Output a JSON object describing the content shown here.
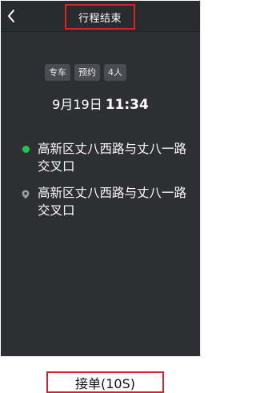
{
  "header": {
    "title": "行程结束"
  },
  "order": {
    "tags": [
      "专车",
      "预约",
      "4人"
    ],
    "date": "9月19日",
    "time": "11:34",
    "start": "高新区丈八西路与丈八一路交叉口",
    "end": "高新区丈八西路与丈八一路交叉口"
  },
  "footer": {
    "accept_label": "接单(10S)"
  },
  "icons": {
    "back": "chevron-left-icon",
    "start": "green-dot-icon",
    "end": "location-pin-icon"
  },
  "colors": {
    "panel": "#2e2f33",
    "highlight_border": "#d9232a",
    "start_dot": "#23c552"
  }
}
